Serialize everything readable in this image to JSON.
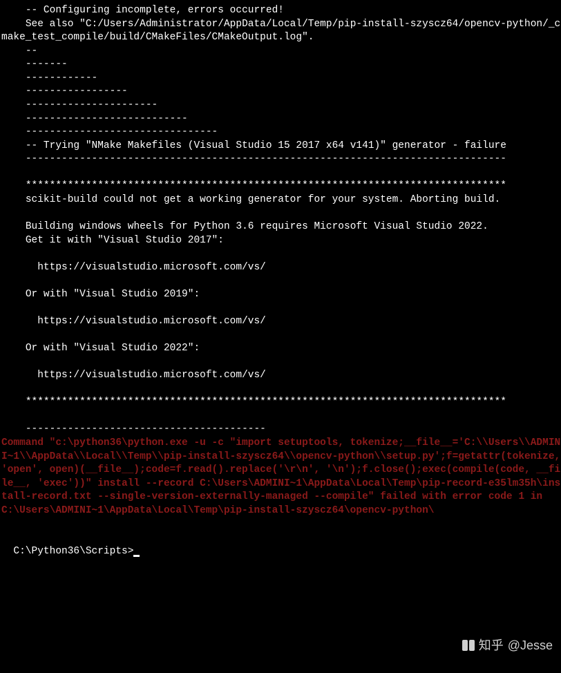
{
  "terminal": {
    "lines": [
      {
        "cls": "line-white",
        "text": "    -- Configuring incomplete, errors occurred!"
      },
      {
        "cls": "line-white",
        "text": "    See also \"C:/Users/Administrator/AppData/Local/Temp/pip-install-szyscz64/opencv-python/_cmake_test_compile/build/CMakeFiles/CMakeOutput.log\"."
      },
      {
        "cls": "line-white",
        "text": "    --"
      },
      {
        "cls": "line-white",
        "text": "    -------"
      },
      {
        "cls": "line-white",
        "text": "    ------------"
      },
      {
        "cls": "line-white",
        "text": "    -----------------"
      },
      {
        "cls": "line-white",
        "text": "    ----------------------"
      },
      {
        "cls": "line-white",
        "text": "    ---------------------------"
      },
      {
        "cls": "line-white",
        "text": "    --------------------------------"
      },
      {
        "cls": "line-white",
        "text": "    -- Trying \"NMake Makefiles (Visual Studio 15 2017 x64 v141)\" generator - failure"
      },
      {
        "cls": "line-white",
        "text": "    --------------------------------------------------------------------------------"
      },
      {
        "cls": "line-white",
        "text": ""
      },
      {
        "cls": "line-white",
        "text": "    ********************************************************************************"
      },
      {
        "cls": "line-white",
        "text": "    scikit-build could not get a working generator for your system. Aborting build."
      },
      {
        "cls": "line-white",
        "text": ""
      },
      {
        "cls": "line-white",
        "text": "    Building windows wheels for Python 3.6 requires Microsoft Visual Studio 2022."
      },
      {
        "cls": "line-white",
        "text": "    Get it with \"Visual Studio 2017\":"
      },
      {
        "cls": "line-white",
        "text": ""
      },
      {
        "cls": "line-white",
        "text": "      https://visualstudio.microsoft.com/vs/"
      },
      {
        "cls": "line-white",
        "text": ""
      },
      {
        "cls": "line-white",
        "text": "    Or with \"Visual Studio 2019\":"
      },
      {
        "cls": "line-white",
        "text": ""
      },
      {
        "cls": "line-white",
        "text": "      https://visualstudio.microsoft.com/vs/"
      },
      {
        "cls": "line-white",
        "text": ""
      },
      {
        "cls": "line-white",
        "text": "    Or with \"Visual Studio 2022\":"
      },
      {
        "cls": "line-white",
        "text": ""
      },
      {
        "cls": "line-white",
        "text": "      https://visualstudio.microsoft.com/vs/"
      },
      {
        "cls": "line-white",
        "text": ""
      },
      {
        "cls": "line-white",
        "text": "    ********************************************************************************"
      },
      {
        "cls": "line-white",
        "text": ""
      },
      {
        "cls": "line-white",
        "text": "    ----------------------------------------"
      },
      {
        "cls": "line-red",
        "text": "Command \"c:\\python36\\python.exe -u -c \"import setuptools, tokenize;__file__='C:\\\\Users\\\\ADMINI~1\\\\AppData\\\\Local\\\\Temp\\\\pip-install-szyscz64\\\\opencv-python\\\\setup.py';f=getattr(tokenize, 'open', open)(__file__);code=f.read().replace('\\r\\n', '\\n');f.close();exec(compile(code, __file__, 'exec'))\" install --record C:\\Users\\ADMINI~1\\AppData\\Local\\Temp\\pip-record-e35lm35h\\install-record.txt --single-version-externally-managed --compile\" failed with error code 1 in C:\\Users\\ADMINI~1\\AppData\\Local\\Temp\\pip-install-szyscz64\\opencv-python\\"
      },
      {
        "cls": "line-white",
        "text": ""
      }
    ],
    "prompt": "C:\\Python36\\Scripts>"
  },
  "watermark": {
    "text": "@Jesse",
    "brand": "知乎"
  }
}
